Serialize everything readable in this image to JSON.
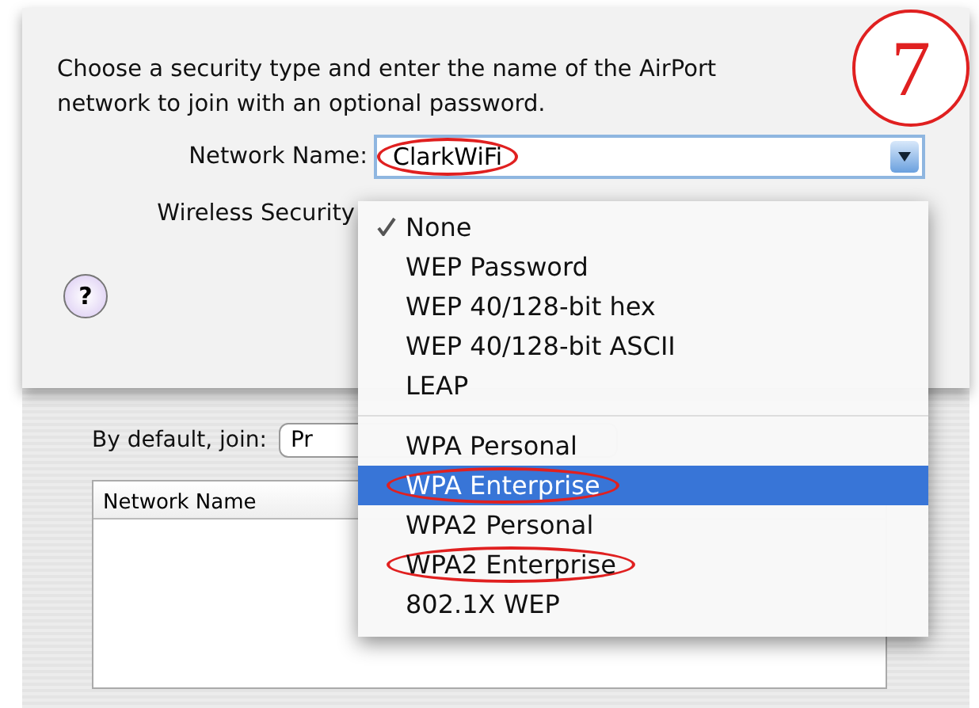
{
  "sheet": {
    "message": "Choose a security type and enter the name of the AirPort network to join with an optional password.",
    "network_name": {
      "label": "Network Name:",
      "value": "ClarkWiFi",
      "circled": true
    },
    "wireless_security": {
      "label": "Wireless Security"
    },
    "help_button": "?"
  },
  "callout": "7",
  "security_menu": {
    "groups": [
      [
        {
          "label": "None",
          "checked": true,
          "selected": false,
          "circled": false
        },
        {
          "label": "WEP Password",
          "checked": false,
          "selected": false,
          "circled": false
        },
        {
          "label": "WEP 40/128-bit hex",
          "checked": false,
          "selected": false,
          "circled": false
        },
        {
          "label": "WEP 40/128-bit ASCII",
          "checked": false,
          "selected": false,
          "circled": false
        },
        {
          "label": "LEAP",
          "checked": false,
          "selected": false,
          "circled": false
        }
      ],
      [
        {
          "label": "WPA Personal",
          "checked": false,
          "selected": false,
          "circled": false
        },
        {
          "label": "WPA Enterprise",
          "checked": false,
          "selected": true,
          "circled": true
        },
        {
          "label": "WPA2 Personal",
          "checked": false,
          "selected": false,
          "circled": false
        },
        {
          "label": "WPA2 Enterprise",
          "checked": false,
          "selected": false,
          "circled": true
        },
        {
          "label": "802.1X WEP",
          "checked": false,
          "selected": false,
          "circled": false
        }
      ]
    ]
  },
  "background_window": {
    "default_join_label": "By default, join:",
    "default_join_value": "Pr",
    "table": {
      "columns": [
        "Network Name"
      ]
    }
  }
}
